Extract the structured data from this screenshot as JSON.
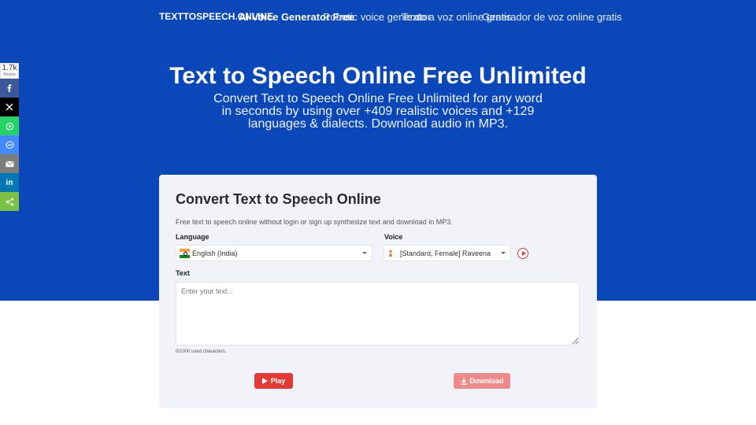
{
  "nav": {
    "brand": "TEXTTOSPEECH.ONLINE",
    "links": [
      {
        "label": "Ai Voice Generator Free"
      },
      {
        "label": "Robotic voice generator"
      },
      {
        "label": "Texto a voz online gratis"
      },
      {
        "label": "Generador de voz online gratis"
      }
    ]
  },
  "hero": {
    "title": "Text to Speech Online Free Unlimited",
    "subtitle": "Convert Text to Speech Online Free Unlimited for any word in seconds by using over +409 realistic voices and +129 languages & dialects. Download audio in MP3."
  },
  "share": {
    "count": "1.7k",
    "count_label": "Shares",
    "buttons": [
      {
        "icon": "facebook-icon"
      },
      {
        "icon": "x-icon"
      },
      {
        "icon": "whatsapp-icon"
      },
      {
        "icon": "messenger-icon"
      },
      {
        "icon": "email-icon"
      },
      {
        "icon": "linkedin-icon"
      },
      {
        "icon": "share-icon"
      }
    ]
  },
  "card": {
    "title": "Convert Text to Speech Online",
    "description": "Free text to speech online without login or sign up synthesize text and download in MP3.",
    "language_label": "Language",
    "language_value": "English (India)",
    "voice_label": "Voice",
    "voice_value": "[Standard, Female] Raveena",
    "text_label": "Text",
    "text_placeholder": "Enter your text...",
    "counter": "0/1000 used characters.",
    "play_label": "Play",
    "download_label": "Download"
  },
  "colors": {
    "hero_bg": "#0a47b8",
    "accent": "#e53935",
    "download_bg": "#ef8a8a"
  }
}
